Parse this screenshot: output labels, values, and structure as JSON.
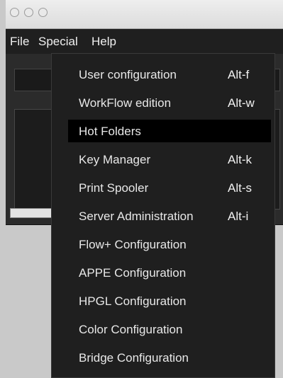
{
  "menubar": {
    "items": [
      {
        "label": "File"
      },
      {
        "label": "Special"
      },
      {
        "label": "Help"
      }
    ]
  },
  "special_menu": {
    "items": [
      {
        "label": "User configuration",
        "accel": "Alt-f"
      },
      {
        "label": "WorkFlow edition",
        "accel": "Alt-w"
      },
      {
        "label": "Hot Folders",
        "accel": "",
        "selected": true
      },
      {
        "label": "Key Manager",
        "accel": "Alt-k"
      },
      {
        "label": "Print Spooler",
        "accel": "Alt-s"
      },
      {
        "label": "Server Administration",
        "accel": "Alt-i"
      },
      {
        "label": "Flow+ Configuration",
        "accel": ""
      },
      {
        "label": "APPE Configuration",
        "accel": ""
      },
      {
        "label": "HPGL Configuration",
        "accel": ""
      },
      {
        "label": "Color Configuration",
        "accel": ""
      },
      {
        "label": "Bridge Configuration",
        "accel": ""
      }
    ]
  }
}
